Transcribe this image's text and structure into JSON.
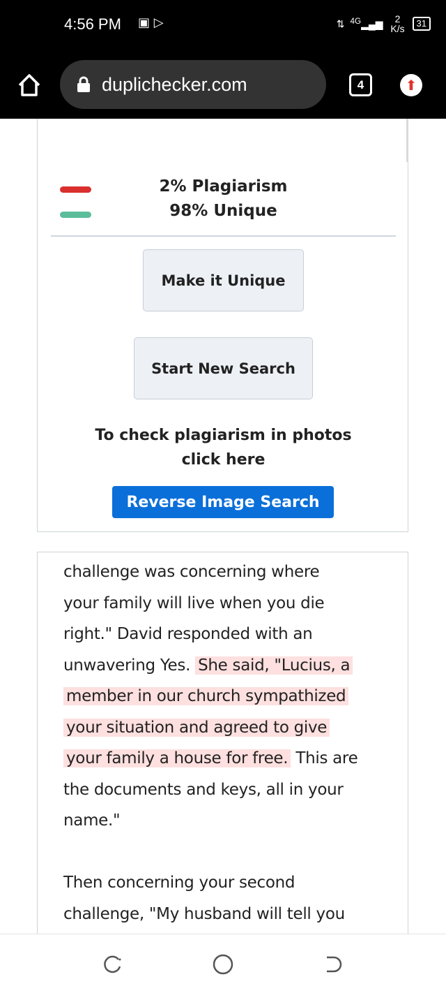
{
  "status": {
    "time": "4:56 PM",
    "network": "4G",
    "speed": "2 K/s",
    "battery": "31"
  },
  "browser": {
    "url": "duplichecker.com",
    "tab_count": "4"
  },
  "result": {
    "plagiarism": "2% Plagiarism",
    "unique": "98% Unique",
    "plagiarism_percent": 2,
    "unique_percent": 98,
    "colors": {
      "plagiarism": "#d9302e",
      "unique": "#5bbd9a"
    }
  },
  "buttons": {
    "make_unique": "Make it Unique",
    "new_search": "Start New Search",
    "reverse": "Reverse Image Search"
  },
  "photo_prompt": {
    "line1": "To check plagiarism in photos",
    "line2": "click here"
  },
  "text_lines": [
    [
      {
        "t": "challenge was concerning where",
        "h": false
      }
    ],
    [
      {
        "t": "your family will live when you die",
        "h": false
      }
    ],
    [
      {
        "t": "right.\" David responded with an",
        "h": false
      }
    ],
    [
      {
        "t": "unwavering Yes. ",
        "h": false
      },
      {
        "t": "She said, \"Lucius, a",
        "h": true
      }
    ],
    [
      {
        "t": "member in our church sympathized",
        "h": true
      }
    ],
    [
      {
        "t": "your situation and agreed to give",
        "h": true
      }
    ],
    [
      {
        "t": "your family a house for free.",
        "h": true
      },
      {
        "t": " This are",
        "h": false
      }
    ],
    [
      {
        "t": "the documents and keys, all in your",
        "h": false
      }
    ],
    [
      {
        "t": "name.\"",
        "h": false
      }
    ],
    [
      {
        "t": "",
        "h": false
      }
    ],
    [
      {
        "t": "Then concerning your second",
        "h": false
      }
    ],
    [
      {
        "t": "challenge, \"My husband will tell you",
        "h": false
      }
    ]
  ]
}
